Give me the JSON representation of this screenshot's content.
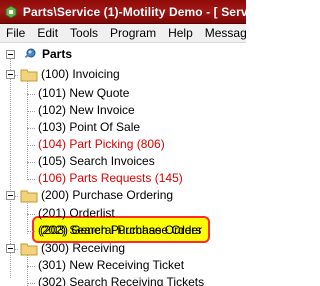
{
  "window": {
    "title": "Parts\\Service (1)-Motility Demo - [ Serv"
  },
  "menu": {
    "items": [
      "File",
      "Edit",
      "Tools",
      "Program",
      "Help",
      "Messaging"
    ]
  },
  "tree": {
    "root": {
      "label": "Parts",
      "icon": "parts-pin-icon"
    },
    "invoicing": {
      "label": "(100) Invoicing",
      "children": [
        {
          "label": "(101) New Quote",
          "color": "black"
        },
        {
          "label": "(102) New Invoice",
          "color": "black"
        },
        {
          "label": "(103) Point Of Sale",
          "color": "black"
        },
        {
          "label": "(104) Part Picking (806)",
          "color": "red"
        },
        {
          "label": "(105) Search Invoices",
          "color": "black"
        },
        {
          "label": "(106) Parts Requests (145)",
          "color": "red"
        }
      ]
    },
    "purchase_ordering": {
      "label": "(200) Purchase Ordering",
      "children": [
        {
          "label": "(201) Orderlist"
        },
        {
          "label": "(202) Search Purchase Orders"
        },
        {
          "label": "(203) General Purchase Order",
          "highlighted": true
        }
      ]
    },
    "receiving": {
      "label": "(300) Receiving",
      "children": [
        {
          "label": "(301) New Receiving Ticket"
        },
        {
          "label": "(302) Search Receiving Tickets"
        }
      ]
    }
  },
  "colors": {
    "titlebar": "#8f0a08",
    "alert_text": "#e00000",
    "highlight_fill": "#fbff0a",
    "highlight_border": "#ff2a2a",
    "folder": "#f2d27a"
  }
}
